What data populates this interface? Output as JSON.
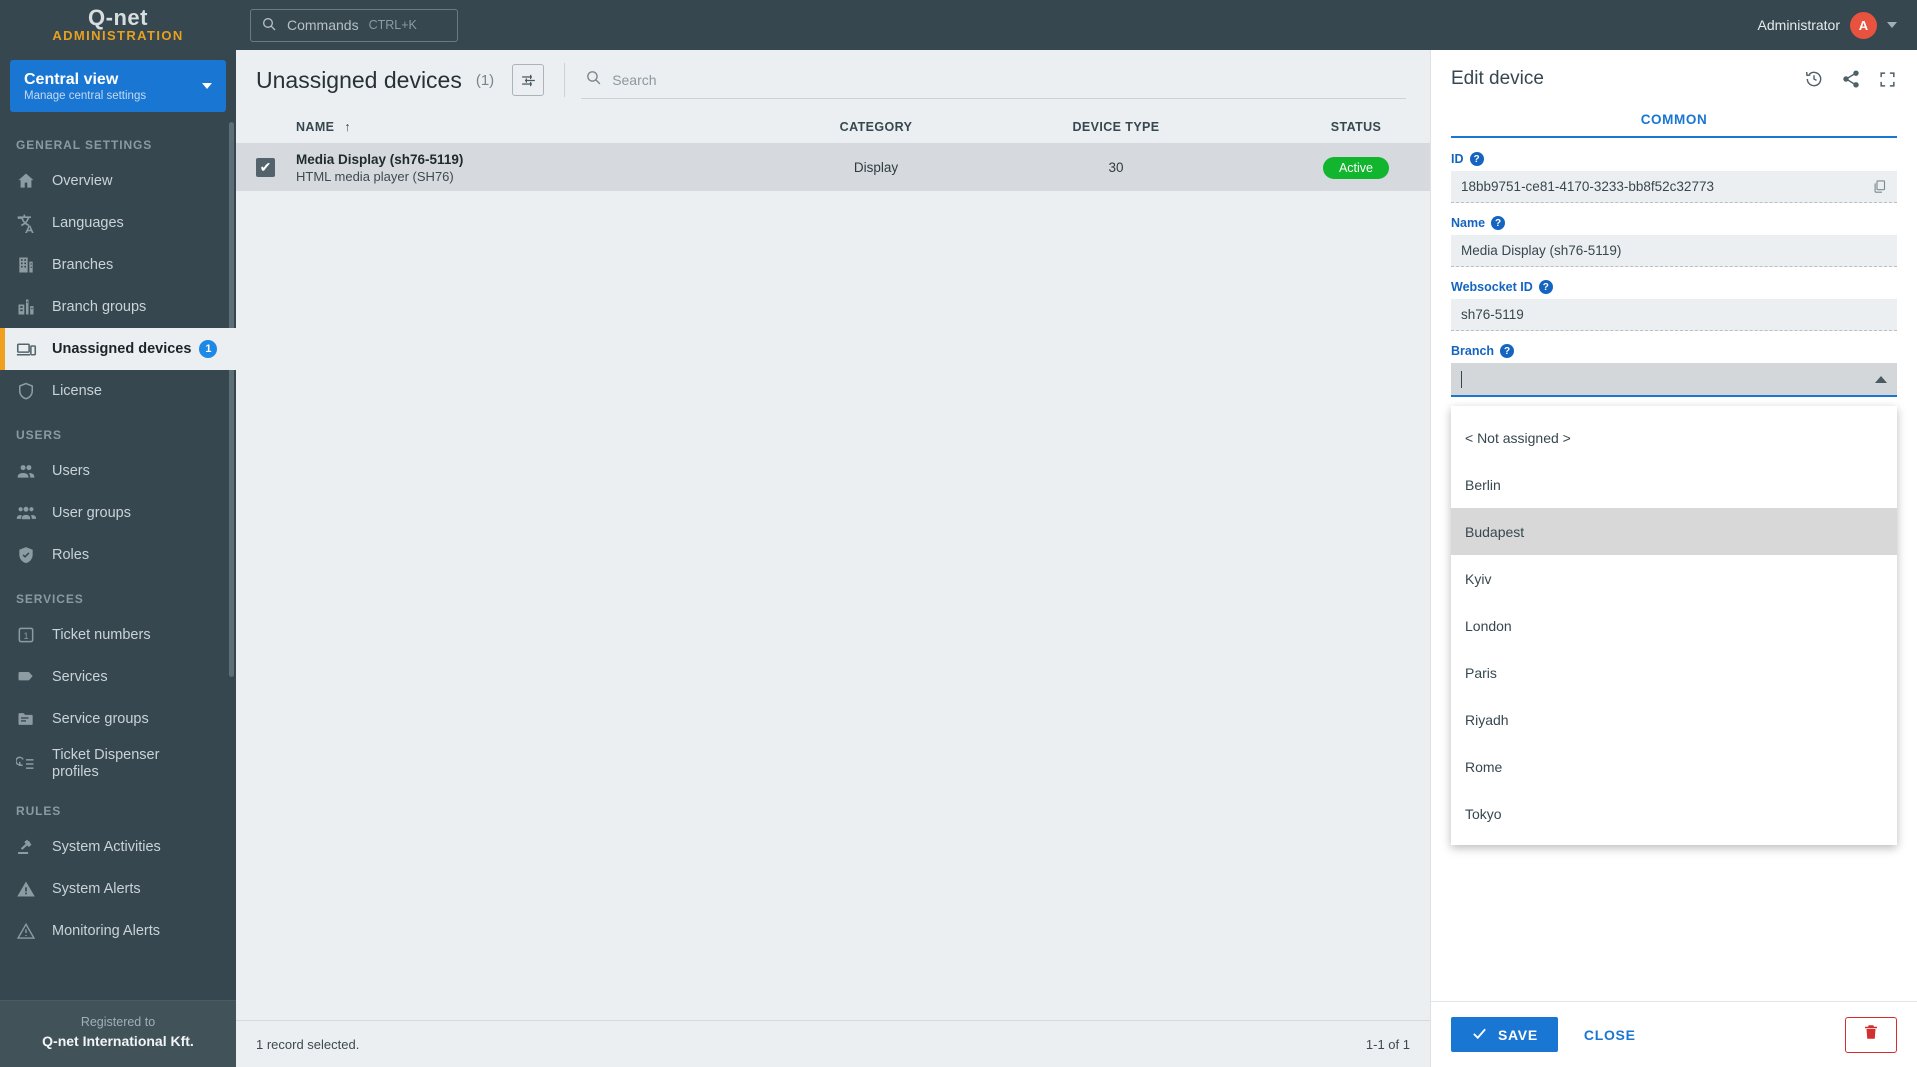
{
  "brand": {
    "logo": "Q-net",
    "subtitle": "ADMINISTRATION"
  },
  "topbar": {
    "commands_label": "Commands",
    "commands_shortcut": "CTRL+K",
    "user_name": "Administrator",
    "avatar_initial": "A"
  },
  "sidebar": {
    "view_switcher": {
      "title": "Central view",
      "subtitle": "Manage central settings"
    },
    "sections": [
      {
        "label": "GENERAL SETTINGS",
        "items": [
          {
            "label": "Overview",
            "icon": "home-icon",
            "active": false,
            "badge": ""
          },
          {
            "label": "Languages",
            "icon": "translate-icon",
            "active": false,
            "badge": ""
          },
          {
            "label": "Branches",
            "icon": "building-icon",
            "active": false,
            "badge": ""
          },
          {
            "label": "Branch groups",
            "icon": "buildings-icon",
            "active": false,
            "badge": ""
          },
          {
            "label": "Unassigned devices",
            "icon": "devices-icon",
            "active": true,
            "badge": "1"
          },
          {
            "label": "License",
            "icon": "shield-icon",
            "active": false,
            "badge": ""
          }
        ]
      },
      {
        "label": "USERS",
        "items": [
          {
            "label": "Users",
            "icon": "users-icon",
            "active": false,
            "badge": ""
          },
          {
            "label": "User groups",
            "icon": "user-group-icon",
            "active": false,
            "badge": ""
          },
          {
            "label": "Roles",
            "icon": "shield-check-icon",
            "active": false,
            "badge": ""
          }
        ]
      },
      {
        "label": "SERVICES",
        "items": [
          {
            "label": "Ticket numbers",
            "icon": "number-one-icon",
            "active": false,
            "badge": ""
          },
          {
            "label": "Services",
            "icon": "tag-icon",
            "active": false,
            "badge": ""
          },
          {
            "label": "Service groups",
            "icon": "folder-icon",
            "active": false,
            "badge": ""
          },
          {
            "label": "Ticket Dispenser profiles",
            "icon": "dispenser-icon",
            "active": false,
            "badge": ""
          }
        ]
      },
      {
        "label": "RULES",
        "items": [
          {
            "label": "System Activities",
            "icon": "gavel-icon",
            "active": false,
            "badge": ""
          },
          {
            "label": "System Alerts",
            "icon": "alert-filled-icon",
            "active": false,
            "badge": ""
          },
          {
            "label": "Monitoring Alerts",
            "icon": "alert-outline-icon",
            "active": false,
            "badge": ""
          }
        ]
      }
    ],
    "footer": {
      "registered_label": "Registered to",
      "company": "Q-net International Kft."
    }
  },
  "main": {
    "page_title": "Unassigned devices",
    "page_count": "(1)",
    "search_placeholder": "Search",
    "search_value": "",
    "columns": [
      "NAME",
      "CATEGORY",
      "DEVICE TYPE",
      "STATUS"
    ],
    "sort_indicator": "↑",
    "rows": [
      {
        "selected": true,
        "name": "Media Display (sh76-5119)",
        "name_sub": "HTML media player (SH76)",
        "category": "Display",
        "device_type": "30",
        "status": "Active",
        "status_color": "#12b52e"
      }
    ],
    "footer_left": "1 record selected.",
    "footer_right": "1-1 of 1"
  },
  "panel": {
    "title": "Edit device",
    "header_icons": [
      "history-icon",
      "share-icon",
      "fullscreen-icon"
    ],
    "tabs": [
      {
        "label": "COMMON",
        "active": true
      }
    ],
    "fields": [
      {
        "label": "ID",
        "value": "18bb9751-ce81-4170-3233-bb8f52c32773",
        "has_copy": true
      },
      {
        "label": "Name",
        "value": "Media Display (sh76-5119)",
        "has_copy": false
      },
      {
        "label": "Websocket ID",
        "value": "sh76-5119",
        "has_copy": false
      }
    ],
    "branch": {
      "label": "Branch",
      "value": "",
      "expanded": true,
      "options": [
        {
          "label": "< Not assigned >",
          "highlighted": false
        },
        {
          "label": "Berlin",
          "highlighted": false
        },
        {
          "label": "Budapest",
          "highlighted": true
        },
        {
          "label": "Kyiv",
          "highlighted": false
        },
        {
          "label": "London",
          "highlighted": false
        },
        {
          "label": "Paris",
          "highlighted": false
        },
        {
          "label": "Riyadh",
          "highlighted": false
        },
        {
          "label": "Rome",
          "highlighted": false
        },
        {
          "label": "Tokyo",
          "highlighted": false
        }
      ]
    },
    "save_label": "SAVE",
    "close_label": "CLOSE",
    "delete_icon": "trash-icon"
  },
  "colors": {
    "accent_blue": "#1976d2",
    "sidebar_bg": "#36474f",
    "active_marker": "#f0a01e",
    "status_green": "#12b52e",
    "delete_red": "#d32f2f",
    "avatar_red": "#e8533f"
  }
}
